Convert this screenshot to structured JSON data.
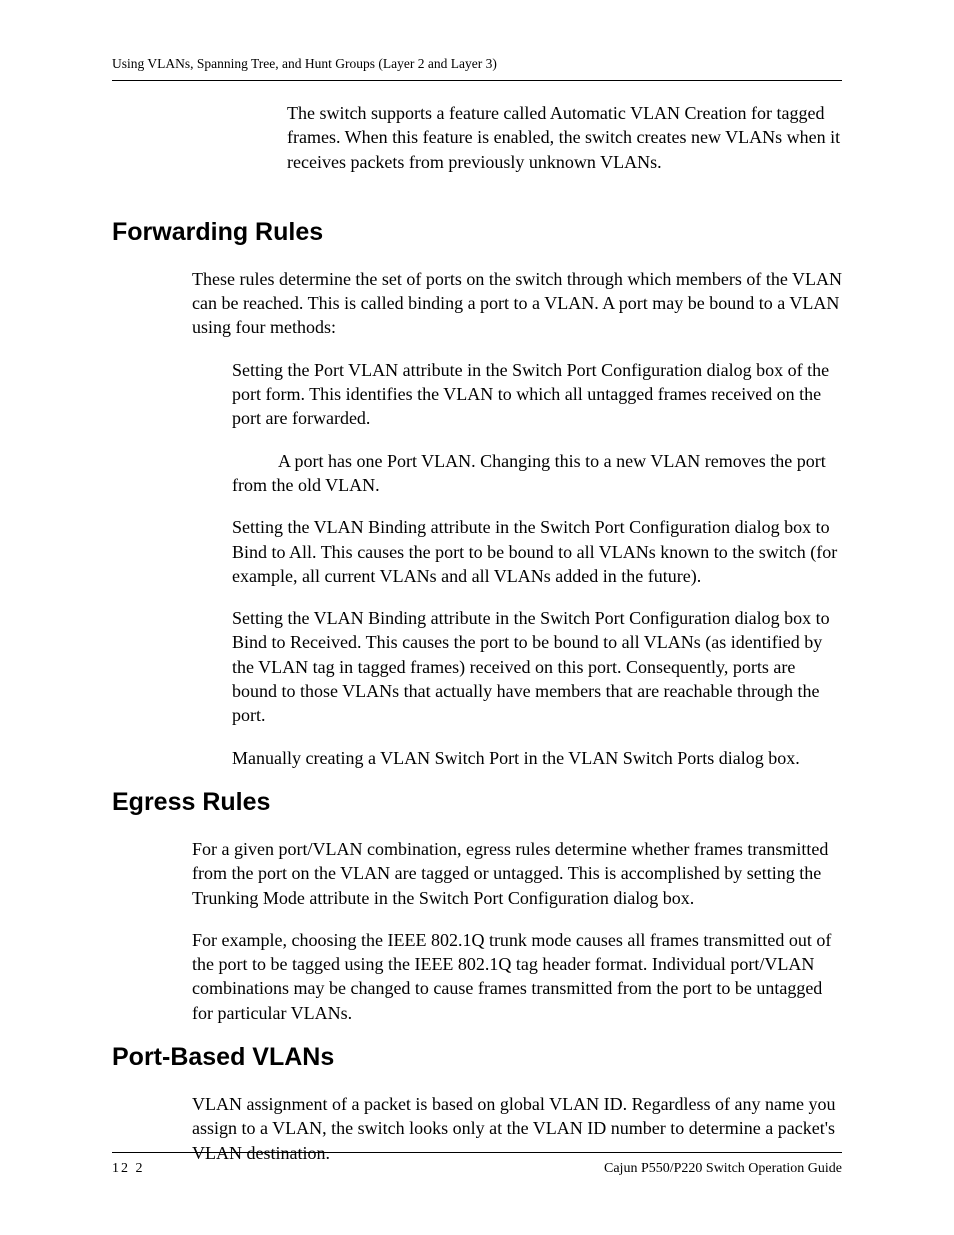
{
  "header": {
    "running": "Using VLANs, Spanning Tree, and Hunt Groups (Layer 2 and Layer 3)"
  },
  "intro": {
    "p1": "The switch supports a feature called Automatic VLAN Creation for tagged frames. When this feature is enabled, the switch creates new VLANs when it receives packets from previously unknown VLANs."
  },
  "sections": {
    "forwarding": {
      "title": "Forwarding Rules",
      "lead": "These rules determine the set of ports on the switch through which members of the VLAN can be reached. This is called binding a port to a VLAN. A port may be bound to a VLAN using four methods:",
      "items": {
        "m1": "Setting the Port VLAN attribute in the Switch Port Configuration dialog box of the port form. This identifies the VLAN to which all untagged frames received on the port are forwarded.",
        "m1b": "A port has one Port VLAN. Changing this to a new VLAN removes the port from the old VLAN.",
        "m2": "Setting the VLAN Binding attribute in the Switch Port Configuration dialog box to Bind to All. This causes the port to be bound to all VLANs known to the switch (for example, all current VLANs and all VLANs added in the future).",
        "m3": "Setting the VLAN Binding attribute in the Switch Port Configuration dialog box to Bind to Received. This causes the port to be bound to all VLANs (as identified by the VLAN tag in tagged frames) received on this port. Consequently, ports are bound to those VLANs that actually have members that are reachable through the port.",
        "m4": "Manually creating a VLAN Switch Port in the VLAN Switch Ports dialog box."
      }
    },
    "egress": {
      "title": "Egress Rules",
      "p1": "For a given port/VLAN combination, egress rules determine whether frames transmitted from the port on the VLAN are tagged or untagged. This is accomplished by setting the Trunking Mode attribute in the Switch Port Configuration dialog box.",
      "p2": "For example, choosing the IEEE 802.1Q trunk mode causes all frames transmitted out of the port to be tagged using the IEEE 802.1Q tag header format. Individual port/VLAN combinations may be changed to cause frames transmitted from the port to be untagged for particular VLANs."
    },
    "portbased": {
      "title": "Port-Based VLANs",
      "p1": "VLAN assignment of a packet is based on global VLAN ID. Regardless of any name you assign to a VLAN, the switch looks only at the VLAN ID number to determine a packet's VLAN destination."
    }
  },
  "footer": {
    "page": "12 2",
    "guide": "Cajun P550/P220 Switch Operation Guide"
  }
}
